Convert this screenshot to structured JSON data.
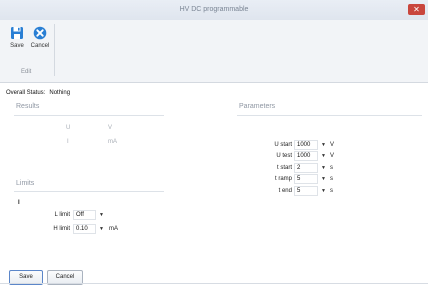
{
  "window": {
    "title": "HV DC programmable",
    "close_glyph": "✕"
  },
  "ribbon": {
    "save_label": "Save",
    "cancel_label": "Cancel",
    "group_label": "Edit",
    "save_icon": "save-icon",
    "cancel_icon": "cancel-icon",
    "accent_color": "#2a7fd4"
  },
  "status": {
    "label": "Overall Status:",
    "value": "Nothing"
  },
  "results": {
    "title": "Results",
    "rows": [
      {
        "name": "U",
        "unit": "V"
      },
      {
        "name": "I",
        "unit": "mA"
      }
    ]
  },
  "limits": {
    "title": "Limits",
    "symbol": "I",
    "l_limit": {
      "label": "L limit",
      "value": "Off",
      "unit": ""
    },
    "h_limit": {
      "label": "H limit",
      "value": "0.10",
      "unit": "mA"
    }
  },
  "parameters": {
    "title": "Parameters",
    "rows": [
      {
        "label": "U start",
        "value": "1000",
        "unit": "V"
      },
      {
        "label": "U test",
        "value": "1000",
        "unit": "V"
      },
      {
        "label": "t start",
        "value": "2",
        "unit": "s"
      },
      {
        "label": "t ramp",
        "value": "5",
        "unit": "s"
      },
      {
        "label": "t end",
        "value": "5",
        "unit": "s"
      }
    ]
  },
  "footer": {
    "save_label": "Save",
    "cancel_label": "Cancel"
  }
}
